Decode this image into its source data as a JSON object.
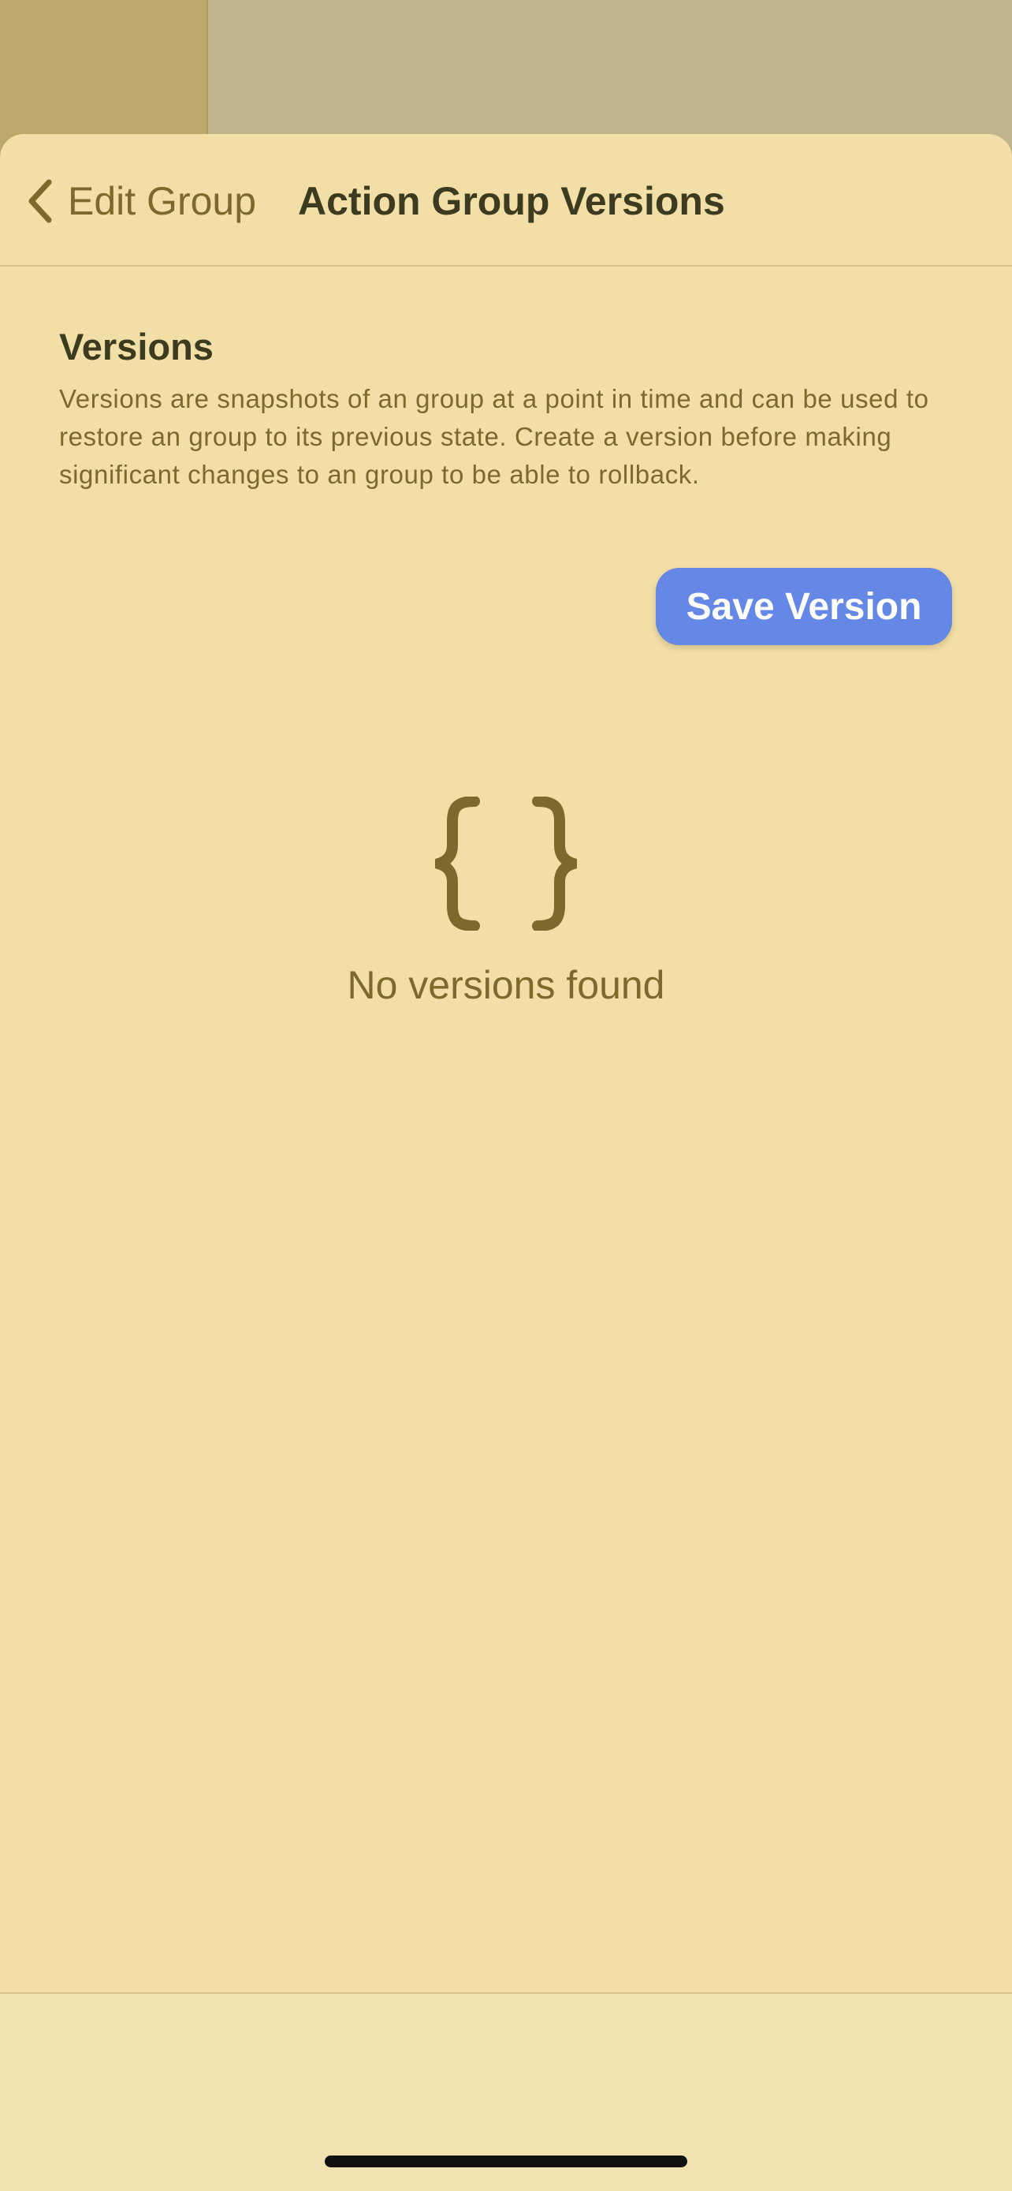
{
  "nav": {
    "back_label": "Edit Group",
    "back_icon": "chevron-left-icon",
    "title": "Action Group Versions"
  },
  "section": {
    "title": "Versions",
    "description": "Versions are snapshots of an group at a point in time and can be used to restore an group to its previous state. Create a version before making significant changes to an group to be able to rollback."
  },
  "actions": {
    "save_label": "Save Version"
  },
  "empty_state": {
    "icon": "curly-braces-icon",
    "label": "No versions found"
  },
  "colors": {
    "sheet_background": "#f2dfa8",
    "accent_button": "#6587e6",
    "text_primary": "#3c3a1f",
    "text_secondary": "#7c6a2c"
  }
}
